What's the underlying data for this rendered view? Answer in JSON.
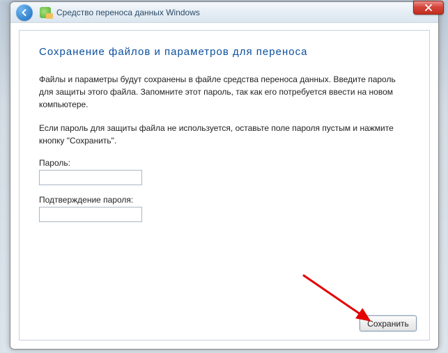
{
  "window": {
    "title": "Средство переноса данных Windows"
  },
  "page": {
    "heading": "Сохранение файлов и параметров для переноса",
    "paragraph1": "Файлы и параметры будут сохранены в файле средства переноса данных. Введите пароль для защиты этого файла. Запомните этот пароль, так как его потребуется ввести на новом компьютере.",
    "paragraph2": "Если пароль для защиты файла не используется, оставьте поле пароля пустым и нажмите кнопку \"Сохранить\"."
  },
  "form": {
    "password_label": "Пароль:",
    "password_value": "",
    "confirm_label": "Подтверждение пароля:",
    "confirm_value": ""
  },
  "buttons": {
    "save": "Сохранить"
  }
}
